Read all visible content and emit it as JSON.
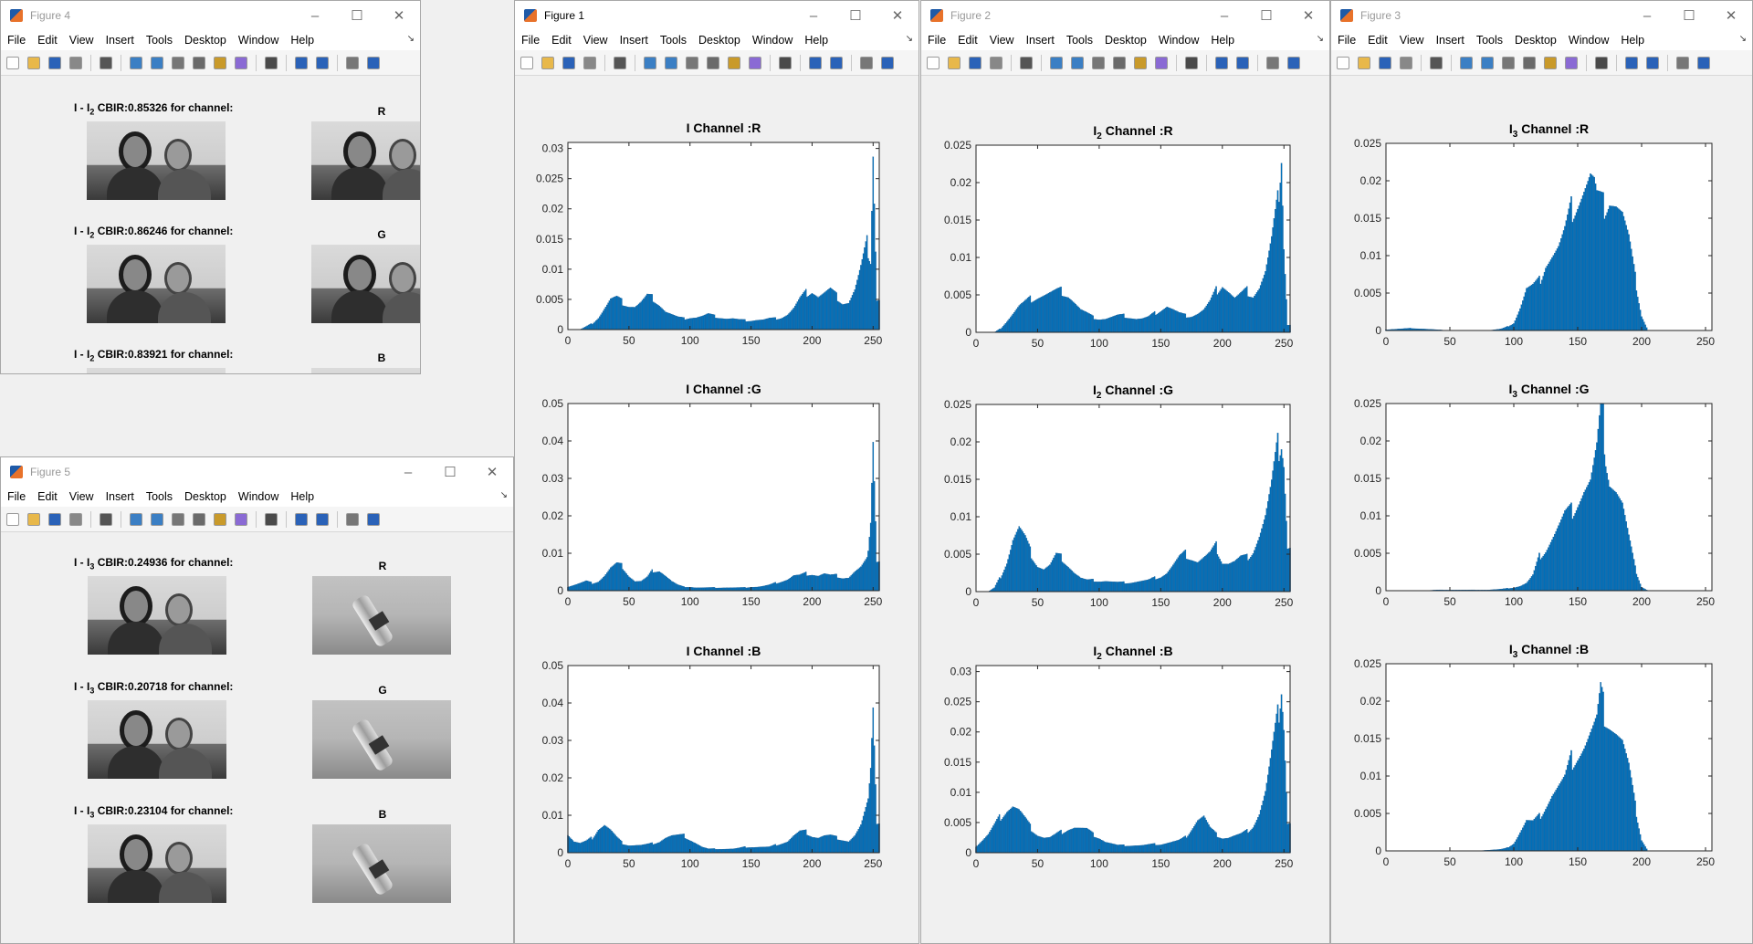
{
  "menu": [
    "File",
    "Edit",
    "View",
    "Insert",
    "Tools",
    "Desktop",
    "Window",
    "Help"
  ],
  "windows": {
    "fig4": {
      "title": "Figure 4"
    },
    "fig5": {
      "title": "Figure 5"
    },
    "fig1": {
      "title": "Figure 1"
    },
    "fig2": {
      "title": "Figure 2"
    },
    "fig3": {
      "title": "Figure 3"
    }
  },
  "fig4": {
    "rows": [
      {
        "prefix": "I - I",
        "sub": "2",
        "suffix": " CBIR:0.85326 for channel:",
        "channel": "R"
      },
      {
        "prefix": "I - I",
        "sub": "2",
        "suffix": " CBIR:0.86246 for channel:",
        "channel": "G"
      },
      {
        "prefix": "I - I",
        "sub": "2",
        "suffix": " CBIR:0.83921 for channel:",
        "channel": "B"
      }
    ]
  },
  "fig5": {
    "rows": [
      {
        "prefix": "I - I",
        "sub": "3",
        "suffix": " CBIR:0.24936 for channel:",
        "channel": "R"
      },
      {
        "prefix": "I - I",
        "sub": "3",
        "suffix": " CBIR:0.20718 for channel:",
        "channel": "G"
      },
      {
        "prefix": "I - I",
        "sub": "3",
        "suffix": " CBIR:0.23104 for channel:",
        "channel": "B"
      }
    ]
  },
  "chart_data": [
    {
      "window": "Figure 1",
      "type": "bar",
      "title": "I Channel :R",
      "title_main": "I",
      "title_sub": "",
      "title_rest": " Channel :R",
      "xlim": [
        0,
        255
      ],
      "xticks": [
        0,
        50,
        100,
        150,
        200,
        250
      ],
      "ylim": [
        0,
        0.031
      ],
      "yticks": [
        0,
        0.005,
        0.01,
        0.015,
        0.02,
        0.025,
        0.03
      ],
      "color": "#0072bd",
      "x": [
        0,
        5,
        10,
        15,
        20,
        25,
        30,
        35,
        40,
        45,
        50,
        55,
        60,
        65,
        70,
        75,
        80,
        85,
        90,
        95,
        100,
        105,
        110,
        115,
        120,
        125,
        130,
        135,
        140,
        145,
        150,
        155,
        160,
        165,
        170,
        175,
        180,
        185,
        190,
        195,
        200,
        205,
        210,
        215,
        220,
        225,
        230,
        235,
        240,
        245,
        248,
        250,
        253
      ],
      "y": [
        0,
        0,
        0,
        0.0005,
        0.001,
        0.002,
        0.0035,
        0.005,
        0.0052,
        0.0045,
        0.004,
        0.0038,
        0.0045,
        0.0055,
        0.0052,
        0.0042,
        0.003,
        0.0025,
        0.002,
        0.0018,
        0.002,
        0.002,
        0.0022,
        0.0025,
        0.0022,
        0.002,
        0.0018,
        0.0018,
        0.0016,
        0.0015,
        0.0015,
        0.0016,
        0.0016,
        0.0018,
        0.0018,
        0.002,
        0.0025,
        0.0035,
        0.005,
        0.006,
        0.0065,
        0.0055,
        0.006,
        0.0065,
        0.0055,
        0.0045,
        0.0045,
        0.0065,
        0.01,
        0.014,
        0.012,
        0.031,
        0.005
      ]
    },
    {
      "window": "Figure 1",
      "type": "bar",
      "title": "I Channel :G",
      "title_main": "I",
      "title_sub": "",
      "title_rest": " Channel :G",
      "xlim": [
        0,
        255
      ],
      "xticks": [
        0,
        50,
        100,
        150,
        200,
        250
      ],
      "ylim": [
        0,
        0.05
      ],
      "yticks": [
        0,
        0.01,
        0.02,
        0.03,
        0.04,
        0.05
      ],
      "color": "#0072bd",
      "x": [
        0,
        5,
        10,
        15,
        20,
        25,
        30,
        35,
        40,
        45,
        50,
        55,
        60,
        65,
        70,
        75,
        80,
        85,
        90,
        95,
        100,
        105,
        110,
        115,
        120,
        125,
        130,
        135,
        140,
        145,
        150,
        155,
        160,
        165,
        170,
        175,
        180,
        185,
        190,
        195,
        200,
        205,
        210,
        215,
        220,
        225,
        230,
        235,
        240,
        245,
        248,
        250,
        253
      ],
      "y": [
        0.001,
        0.0015,
        0.002,
        0.0025,
        0.002,
        0.0025,
        0.004,
        0.006,
        0.007,
        0.0065,
        0.004,
        0.0025,
        0.0025,
        0.0035,
        0.0055,
        0.0055,
        0.004,
        0.0025,
        0.0015,
        0.001,
        0.001,
        0.0008,
        0.0008,
        0.0008,
        0.0008,
        0.0008,
        0.0008,
        0.0008,
        0.0008,
        0.0008,
        0.001,
        0.001,
        0.0012,
        0.0015,
        0.002,
        0.0025,
        0.003,
        0.004,
        0.004,
        0.0045,
        0.0045,
        0.004,
        0.0045,
        0.004,
        0.004,
        0.0035,
        0.0035,
        0.005,
        0.006,
        0.008,
        0.02,
        0.043,
        0.008
      ]
    },
    {
      "window": "Figure 1",
      "type": "bar",
      "title": "I Channel :B",
      "title_main": "I",
      "title_sub": "",
      "title_rest": " Channel :B",
      "xlim": [
        0,
        255
      ],
      "xticks": [
        0,
        50,
        100,
        150,
        200,
        250
      ],
      "ylim": [
        0,
        0.05
      ],
      "yticks": [
        0,
        0.01,
        0.02,
        0.03,
        0.04,
        0.05
      ],
      "color": "#0072bd",
      "x": [
        0,
        5,
        10,
        15,
        20,
        25,
        30,
        35,
        40,
        45,
        50,
        55,
        60,
        65,
        70,
        75,
        80,
        85,
        90,
        95,
        100,
        105,
        110,
        115,
        120,
        125,
        130,
        135,
        140,
        145,
        150,
        155,
        160,
        165,
        170,
        175,
        180,
        185,
        190,
        195,
        200,
        205,
        210,
        215,
        220,
        225,
        230,
        235,
        240,
        245,
        248,
        250,
        253
      ],
      "y": [
        0.005,
        0.003,
        0.0025,
        0.003,
        0.004,
        0.0065,
        0.0075,
        0.006,
        0.004,
        0.0025,
        0.002,
        0.002,
        0.002,
        0.0022,
        0.0025,
        0.003,
        0.004,
        0.0045,
        0.0045,
        0.0045,
        0.0035,
        0.0025,
        0.0015,
        0.001,
        0.001,
        0.001,
        0.001,
        0.001,
        0.0012,
        0.0015,
        0.0015,
        0.0015,
        0.0015,
        0.0015,
        0.002,
        0.0025,
        0.003,
        0.0045,
        0.0055,
        0.0055,
        0.0045,
        0.004,
        0.0045,
        0.0045,
        0.004,
        0.0035,
        0.003,
        0.0045,
        0.007,
        0.012,
        0.025,
        0.042,
        0.008
      ]
    },
    {
      "window": "Figure 2",
      "type": "bar",
      "title": "I2 Channel :R",
      "title_main": "I",
      "title_sub": "2",
      "title_rest": " Channel :R",
      "xlim": [
        0,
        255
      ],
      "xticks": [
        0,
        50,
        100,
        150,
        200,
        250
      ],
      "ylim": [
        0,
        0.025
      ],
      "yticks": [
        0,
        0.005,
        0.01,
        0.015,
        0.02,
        0.025
      ],
      "color": "#0072bd",
      "x": [
        0,
        5,
        10,
        15,
        20,
        25,
        30,
        35,
        40,
        45,
        50,
        55,
        60,
        65,
        70,
        75,
        80,
        85,
        90,
        95,
        100,
        105,
        110,
        115,
        120,
        125,
        130,
        135,
        140,
        145,
        150,
        155,
        160,
        165,
        170,
        175,
        180,
        185,
        190,
        195,
        200,
        205,
        210,
        215,
        220,
        225,
        230,
        235,
        240,
        245,
        248,
        250,
        253
      ],
      "y": [
        0,
        0,
        0,
        0,
        0.0005,
        0.0015,
        0.0025,
        0.0035,
        0.004,
        0.0045,
        0.0048,
        0.005,
        0.0052,
        0.0054,
        0.0055,
        0.005,
        0.004,
        0.003,
        0.0025,
        0.002,
        0.0018,
        0.0018,
        0.002,
        0.0022,
        0.0022,
        0.002,
        0.0018,
        0.0018,
        0.002,
        0.0025,
        0.003,
        0.0035,
        0.003,
        0.0025,
        0.0022,
        0.0022,
        0.0025,
        0.003,
        0.004,
        0.0055,
        0.0065,
        0.0055,
        0.0045,
        0.005,
        0.0055,
        0.005,
        0.006,
        0.008,
        0.012,
        0.017,
        0.025,
        0.012,
        0.001
      ]
    },
    {
      "window": "Figure 2",
      "type": "bar",
      "title": "I2 Channel :G",
      "title_main": "I",
      "title_sub": "2",
      "title_rest": " Channel :G",
      "xlim": [
        0,
        255
      ],
      "xticks": [
        0,
        50,
        100,
        150,
        200,
        250
      ],
      "ylim": [
        0,
        0.025
      ],
      "yticks": [
        0,
        0.005,
        0.01,
        0.015,
        0.02,
        0.025
      ],
      "color": "#0072bd",
      "x": [
        0,
        5,
        10,
        15,
        20,
        25,
        30,
        35,
        40,
        45,
        50,
        55,
        60,
        65,
        70,
        75,
        80,
        85,
        90,
        95,
        100,
        105,
        110,
        115,
        120,
        125,
        130,
        135,
        140,
        145,
        150,
        155,
        160,
        165,
        170,
        175,
        180,
        185,
        190,
        195,
        200,
        205,
        210,
        215,
        220,
        225,
        230,
        235,
        240,
        245,
        248,
        250,
        253
      ],
      "y": [
        0,
        0,
        0,
        0.0005,
        0.002,
        0.004,
        0.007,
        0.0085,
        0.007,
        0.005,
        0.0035,
        0.003,
        0.0035,
        0.0048,
        0.0045,
        0.0035,
        0.0025,
        0.0018,
        0.0015,
        0.0015,
        0.0014,
        0.0014,
        0.0013,
        0.0012,
        0.0012,
        0.0012,
        0.0013,
        0.0014,
        0.0015,
        0.0018,
        0.002,
        0.0025,
        0.0035,
        0.0045,
        0.005,
        0.0045,
        0.004,
        0.0045,
        0.005,
        0.006,
        0.004,
        0.0038,
        0.004,
        0.0045,
        0.0045,
        0.0055,
        0.0075,
        0.01,
        0.014,
        0.019,
        0.021,
        0.018,
        0.006
      ]
    },
    {
      "window": "Figure 2",
      "type": "bar",
      "title": "I2 Channel :B",
      "title_main": "I",
      "title_sub": "2",
      "title_rest": " Channel :B",
      "xlim": [
        0,
        255
      ],
      "xticks": [
        0,
        50,
        100,
        150,
        200,
        250
      ],
      "ylim": [
        0,
        0.031
      ],
      "yticks": [
        0,
        0.005,
        0.01,
        0.015,
        0.02,
        0.025,
        0.03
      ],
      "color": "#0072bd",
      "x": [
        0,
        5,
        10,
        15,
        20,
        25,
        30,
        35,
        40,
        45,
        50,
        55,
        60,
        65,
        70,
        75,
        80,
        85,
        90,
        95,
        100,
        105,
        110,
        115,
        120,
        125,
        130,
        135,
        140,
        145,
        150,
        155,
        160,
        165,
        170,
        175,
        180,
        185,
        190,
        195,
        200,
        205,
        210,
        215,
        220,
        225,
        230,
        235,
        240,
        245,
        248,
        250,
        253
      ],
      "y": [
        0.001,
        0.002,
        0.003,
        0.0045,
        0.006,
        0.0072,
        0.0078,
        0.007,
        0.0055,
        0.004,
        0.003,
        0.0025,
        0.0025,
        0.003,
        0.0035,
        0.004,
        0.0042,
        0.004,
        0.0038,
        0.003,
        0.0025,
        0.0018,
        0.0015,
        0.0012,
        0.0012,
        0.0012,
        0.0012,
        0.0012,
        0.0013,
        0.0014,
        0.0014,
        0.0016,
        0.0018,
        0.002,
        0.0025,
        0.004,
        0.0055,
        0.006,
        0.004,
        0.003,
        0.0025,
        0.0025,
        0.0028,
        0.003,
        0.0035,
        0.0045,
        0.0065,
        0.01,
        0.016,
        0.022,
        0.029,
        0.022,
        0.005
      ]
    },
    {
      "window": "Figure 3",
      "type": "bar",
      "title": "I3 Channel :R",
      "title_main": "I",
      "title_sub": "3",
      "title_rest": " Channel :R",
      "xlim": [
        0,
        255
      ],
      "xticks": [
        0,
        50,
        100,
        150,
        200,
        250
      ],
      "ylim": [
        0,
        0.025
      ],
      "yticks": [
        0,
        0.005,
        0.01,
        0.015,
        0.02,
        0.025
      ],
      "color": "#0072bd",
      "x": [
        0,
        10,
        20,
        30,
        40,
        50,
        60,
        70,
        80,
        90,
        95,
        100,
        105,
        110,
        115,
        120,
        125,
        130,
        135,
        140,
        145,
        150,
        155,
        160,
        163,
        165,
        170,
        175,
        180,
        185,
        190,
        195,
        200,
        205,
        210,
        220,
        230,
        240,
        250
      ],
      "y": [
        0.0001,
        0.0002,
        0.0003,
        0.0002,
        0.0001,
        0,
        0,
        0,
        0,
        0.0002,
        0.0005,
        0.001,
        0.003,
        0.0055,
        0.0058,
        0.0065,
        0.009,
        0.01,
        0.011,
        0.013,
        0.016,
        0.0175,
        0.019,
        0.0205,
        0.0195,
        0.0175,
        0.0165,
        0.018,
        0.017,
        0.0155,
        0.012,
        0.007,
        0.002,
        0,
        0,
        0,
        0,
        0,
        0
      ]
    },
    {
      "window": "Figure 3",
      "type": "bar",
      "title": "I3 Channel :G",
      "title_main": "I",
      "title_sub": "3",
      "title_rest": " Channel :G",
      "xlim": [
        0,
        255
      ],
      "xticks": [
        0,
        50,
        100,
        150,
        200,
        250
      ],
      "ylim": [
        0,
        0.025
      ],
      "yticks": [
        0,
        0.005,
        0.01,
        0.015,
        0.02,
        0.025
      ],
      "color": "#0072bd",
      "x": [
        0,
        10,
        20,
        30,
        40,
        50,
        60,
        70,
        80,
        90,
        95,
        100,
        105,
        110,
        115,
        120,
        125,
        130,
        135,
        140,
        145,
        150,
        155,
        160,
        165,
        168,
        170,
        172,
        175,
        180,
        185,
        190,
        195,
        200,
        205,
        210,
        220,
        230,
        240,
        250
      ],
      "y": [
        0,
        0,
        0,
        0,
        0.0001,
        0.0001,
        0.0001,
        0.0001,
        0.0001,
        0.0002,
        0.0003,
        0.0004,
        0.0006,
        0.001,
        0.002,
        0.0045,
        0.0055,
        0.007,
        0.0085,
        0.01,
        0.0105,
        0.012,
        0.0135,
        0.0145,
        0.0185,
        0.023,
        0.0225,
        0.0185,
        0.015,
        0.0135,
        0.0115,
        0.007,
        0.003,
        0.0005,
        0,
        0,
        0,
        0,
        0,
        0
      ]
    },
    {
      "window": "Figure 3",
      "type": "bar",
      "title": "I3 Channel :B",
      "title_main": "I",
      "title_sub": "3",
      "title_rest": " Channel :B",
      "xlim": [
        0,
        255
      ],
      "xticks": [
        0,
        50,
        100,
        150,
        200,
        250
      ],
      "ylim": [
        0,
        0.025
      ],
      "yticks": [
        0,
        0.005,
        0.01,
        0.015,
        0.02,
        0.025
      ],
      "color": "#0072bd",
      "x": [
        0,
        10,
        20,
        30,
        40,
        50,
        60,
        70,
        80,
        90,
        95,
        100,
        105,
        110,
        115,
        120,
        125,
        130,
        135,
        140,
        145,
        150,
        155,
        160,
        165,
        168,
        170,
        175,
        180,
        185,
        190,
        195,
        200,
        205,
        210,
        220,
        230,
        240,
        250
      ],
      "y": [
        0,
        0,
        0,
        0,
        0,
        0,
        0,
        0,
        0.0001,
        0.0002,
        0.0004,
        0.001,
        0.0025,
        0.004,
        0.0038,
        0.0045,
        0.006,
        0.0075,
        0.0085,
        0.0095,
        0.012,
        0.013,
        0.014,
        0.0155,
        0.017,
        0.0205,
        0.019,
        0.0175,
        0.016,
        0.0145,
        0.011,
        0.006,
        0.0015,
        0,
        0,
        0,
        0,
        0,
        0
      ]
    }
  ]
}
